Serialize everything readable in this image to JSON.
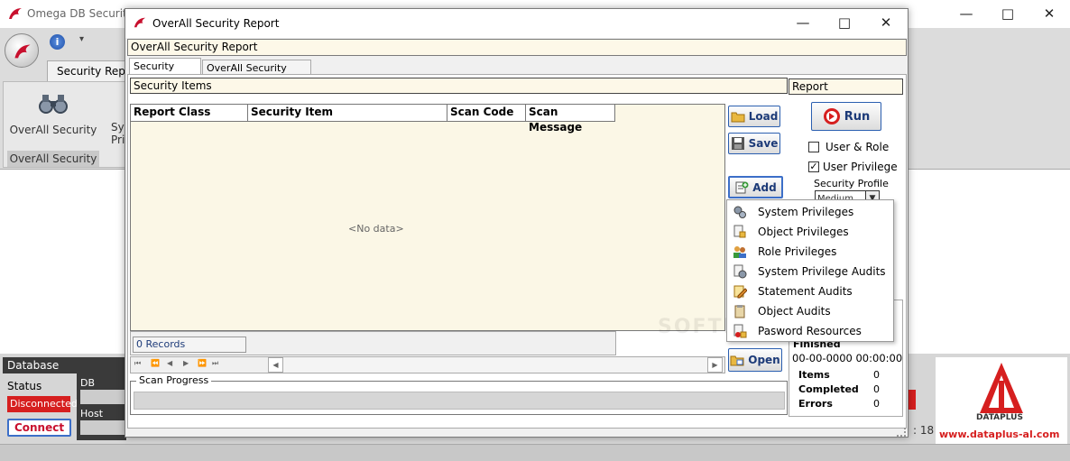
{
  "main_window": {
    "title": "Omega DB Security R",
    "ribbon_tab": "Security Report",
    "ribbon_buttons": [
      {
        "label": "OverAll Security"
      },
      {
        "label": "Sys Pri"
      }
    ],
    "ribbon_group": "OverAll Security"
  },
  "database_panel": {
    "header": "Database",
    "status_label": "Status",
    "status_value": "Disconnected",
    "connect_label": "Connect",
    "db_label": "DB",
    "host_label": "Host",
    "right_value": ": 18"
  },
  "logo": {
    "brand": "DATAPLUS",
    "url": "www.dataplus-al.com"
  },
  "dialog": {
    "title": "OverAll Security Report",
    "caption": "OverAll Security Report",
    "tabs": [
      {
        "label": "Security Items"
      },
      {
        "label": "OverAll Security Report"
      }
    ],
    "items_header": "Security Items",
    "columns": [
      "Report Class",
      "Security Item",
      "Scan Code",
      "Scan Message"
    ],
    "empty_text": "<No data>",
    "records": "0 Records",
    "scan_progress_label": "Scan Progress",
    "buttons": {
      "load": "Load",
      "save": "Save",
      "add": "Add",
      "open": "Open",
      "run": "Run"
    },
    "report_header": "Report",
    "checkbox_user_role": "User & Role",
    "checkbox_user_privilege": "User Privilege",
    "security_profile_label": "Security Profile",
    "security_profile_value": "Medium",
    "finished_label": "Finished",
    "finished_value": "00-00-0000 00:00:00",
    "partial_time": "0",
    "stats": [
      {
        "label": "Items",
        "value": "0"
      },
      {
        "label": "Completed",
        "value": "0"
      },
      {
        "label": "Errors",
        "value": "0"
      }
    ],
    "add_menu": [
      "System Privileges",
      "Object Privileges",
      "Role Privileges",
      "System Privilege Audits",
      "Statement Audits",
      "Object Audits",
      "Pasword Resources"
    ]
  },
  "watermark": "SOFTPEDIA"
}
